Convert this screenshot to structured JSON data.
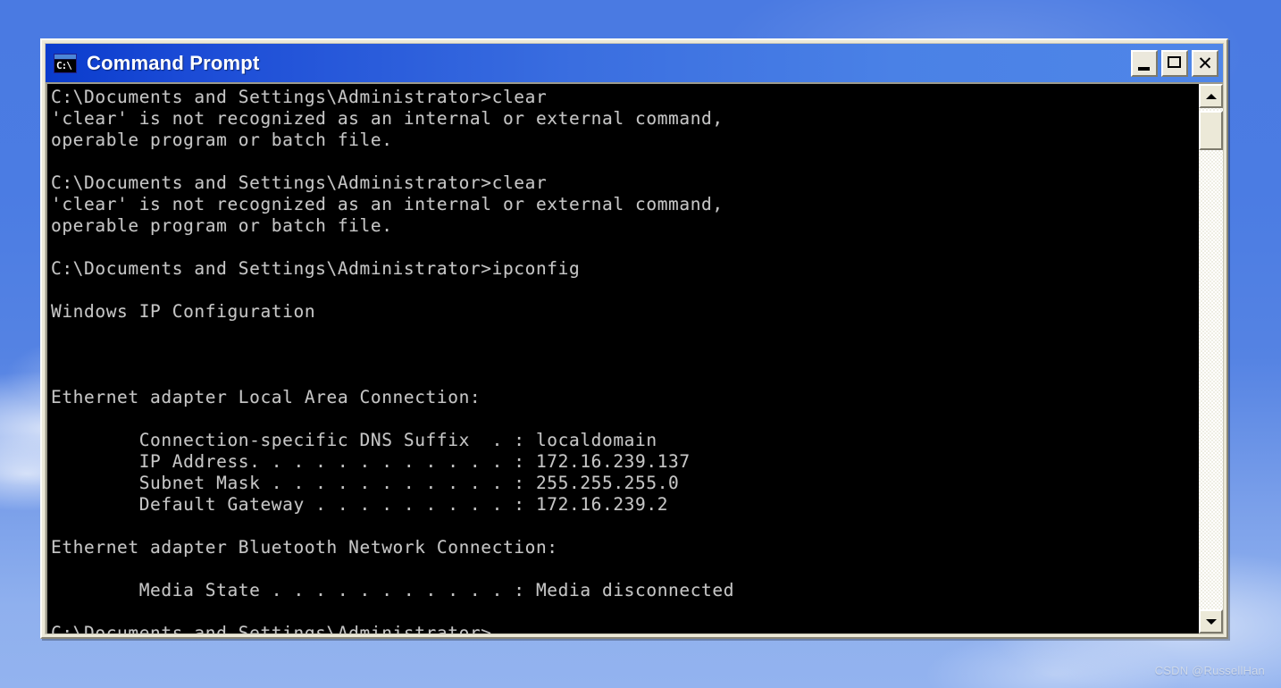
{
  "desktop": {
    "watermark": "CSDN @RussellHan",
    "background_color": "#4a7ae2"
  },
  "window": {
    "title": "Command Prompt",
    "icon_name": "command-prompt-icon",
    "icon_label": "C:\\",
    "titlebar_gradient_start": "#0a3ccd",
    "titlebar_gradient_end": "#4f86e8",
    "controls": {
      "minimize_label": "_",
      "maximize_label": "□",
      "close_label": "✕"
    }
  },
  "console": {
    "background_color": "#000000",
    "text_color": "#c6c6c6",
    "lines": [
      "C:\\Documents and Settings\\Administrator>clear",
      "'clear' is not recognized as an internal or external command,",
      "operable program or batch file.",
      "",
      "C:\\Documents and Settings\\Administrator>clear",
      "'clear' is not recognized as an internal or external command,",
      "operable program or batch file.",
      "",
      "C:\\Documents and Settings\\Administrator>ipconfig",
      "",
      "Windows IP Configuration",
      "",
      "",
      "",
      "Ethernet adapter Local Area Connection:",
      "",
      "        Connection-specific DNS Suffix  . : localdomain",
      "        IP Address. . . . . . . . . . . . : 172.16.239.137",
      "        Subnet Mask . . . . . . . . . . . : 255.255.255.0",
      "        Default Gateway . . . . . . . . . : 172.16.239.2",
      "",
      "Ethernet adapter Bluetooth Network Connection:",
      "",
      "        Media State . . . . . . . . . . . : Media disconnected",
      "",
      "C:\\Documents and Settings\\Administrator>"
    ]
  },
  "scrollbar": {
    "up_arrow": "▲",
    "down_arrow": "▼"
  }
}
